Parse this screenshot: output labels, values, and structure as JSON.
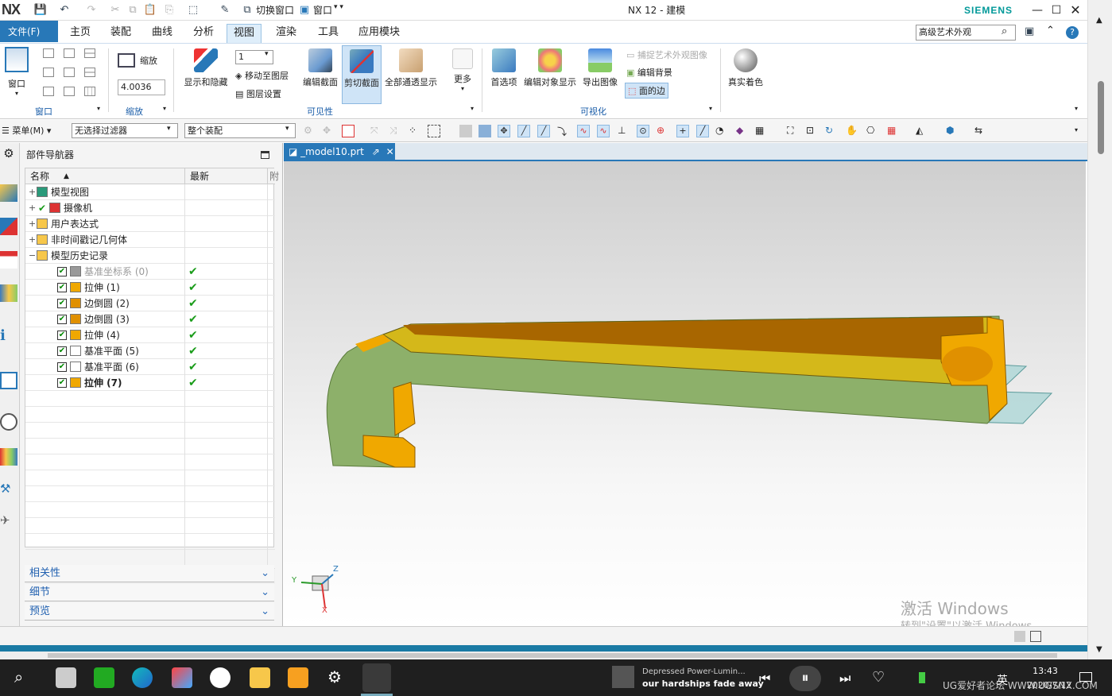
{
  "app": {
    "logo": "NX",
    "title": "NX 12 - 建模",
    "brand": "SIEMENS",
    "switch_window": "切换窗口",
    "window_menu": "窗口"
  },
  "tabs": [
    "文件(F)",
    "主页",
    "装配",
    "曲线",
    "分析",
    "视图",
    "渲染",
    "工具",
    "应用模块"
  ],
  "search": {
    "value": "高级艺术外观"
  },
  "ribbon": {
    "window": {
      "label": "窗口",
      "group": "窗口"
    },
    "zoom": {
      "label": "缩放",
      "value": "4.0036",
      "group": "缩放"
    },
    "show_hide": "显示和隐藏",
    "layer_value": "1",
    "move_to_layer": "移动至图层",
    "layer_settings": "图层设置",
    "edit_section": "编辑截面",
    "clip_section": "剪切截面",
    "all_transparent": "全部通透显示",
    "more": "更多",
    "group_visibility": "可见性",
    "preferences": "首选项",
    "edit_object_display": "编辑对象显示",
    "export_image": "导出图像",
    "capture_studio": "捕捉艺术外观图像",
    "edit_background": "编辑背景",
    "face_edges": "面的边",
    "group_visualization": "可视化",
    "true_shading": "真实着色"
  },
  "toolbar2": {
    "menu": "菜单(M)",
    "filter": "无选择过滤器",
    "assembly": "整个装配"
  },
  "navigator": {
    "title": "部件导航器",
    "col_name": "名称",
    "col_latest": "最新",
    "col_extra": "附",
    "top_items": [
      {
        "label": "模型视图",
        "icon": "views-icon"
      },
      {
        "label": "摄像机",
        "icon": "camera-icon"
      },
      {
        "label": "用户表达式",
        "icon": "folder-icon"
      },
      {
        "label": "非时间戳记几何体",
        "icon": "folder-icon"
      },
      {
        "label": "模型历史记录",
        "icon": "folder-open-icon"
      }
    ],
    "history": [
      {
        "label": "基准坐标系 (0)",
        "icon": "datum-csys-icon",
        "dim": true,
        "bold": false
      },
      {
        "label": "拉伸 (1)",
        "icon": "extrude-icon",
        "dim": false,
        "bold": false
      },
      {
        "label": "边倒圆 (2)",
        "icon": "edge-blend-icon",
        "dim": false,
        "bold": false
      },
      {
        "label": "边倒圆 (3)",
        "icon": "edge-blend-icon",
        "dim": false,
        "bold": false
      },
      {
        "label": "拉伸 (4)",
        "icon": "extrude-icon",
        "dim": false,
        "bold": false
      },
      {
        "label": "基准平面 (5)",
        "icon": "datum-plane-icon",
        "dim": false,
        "bold": false
      },
      {
        "label": "基准平面 (6)",
        "icon": "datum-plane-icon",
        "dim": false,
        "bold": false
      },
      {
        "label": "拉伸 (7)",
        "icon": "extrude-icon",
        "dim": false,
        "bold": true
      }
    ],
    "panels": [
      "相关性",
      "细节",
      "预览"
    ]
  },
  "document_tab": "_model10.prt",
  "triad": {
    "x": "X",
    "y": "Y",
    "z": "Z"
  },
  "watermark": {
    "line1": "激活 Windows",
    "line2": "转到\"设置\"以激活 Windows。"
  },
  "taskbar": {
    "media_title": "Depressed Power-Lumin...",
    "media_subtitle": "our hardships fade away",
    "ime": "英",
    "time": "13:43",
    "date": "2020/7/12",
    "site": "UG爱好者论坛 WWW.UGSNX.COM"
  },
  "colors": {
    "accent": "#2878b8",
    "part_green": "#8db06a",
    "part_orange": "#f0a800",
    "part_dark": "#a86600"
  }
}
